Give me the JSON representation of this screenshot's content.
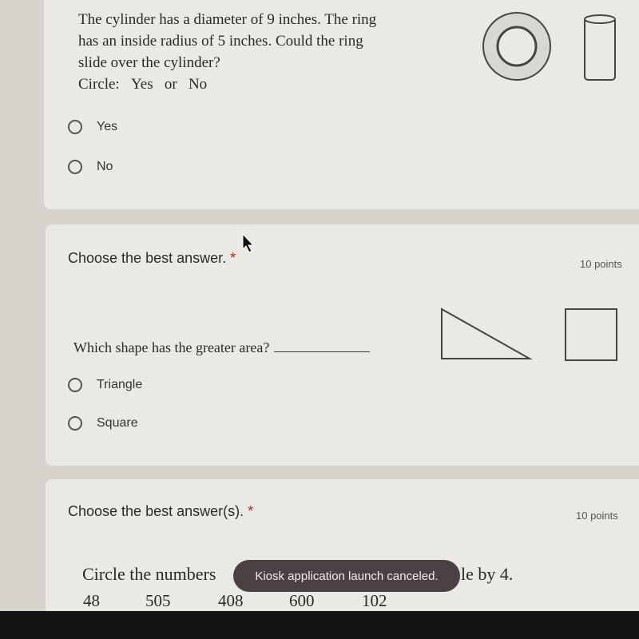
{
  "question1": {
    "lines": [
      "The cylinder has a diameter of 9 inches. The ring",
      "has an inside radius of 5 inches. Could the ring",
      "slide over the cylinder?"
    ],
    "circle_label": "Circle:",
    "circle_yes": "Yes",
    "circle_or": "or",
    "circle_no": "No",
    "options": [
      "Yes",
      "No"
    ]
  },
  "question2": {
    "title": "Choose the best answer.",
    "required": "*",
    "points": "10 points",
    "prompt": "Which shape has the greater area?",
    "options": [
      "Triangle",
      "Square"
    ]
  },
  "question3": {
    "title": "Choose the best answer(s).",
    "required": "*",
    "points": "10 points",
    "prompt_start": "Circle the numbers",
    "prompt_end": "le by 4.",
    "numbers": [
      "48",
      "505",
      "408",
      "600",
      "102"
    ]
  },
  "toast": {
    "message": "Kiosk application launch canceled."
  }
}
